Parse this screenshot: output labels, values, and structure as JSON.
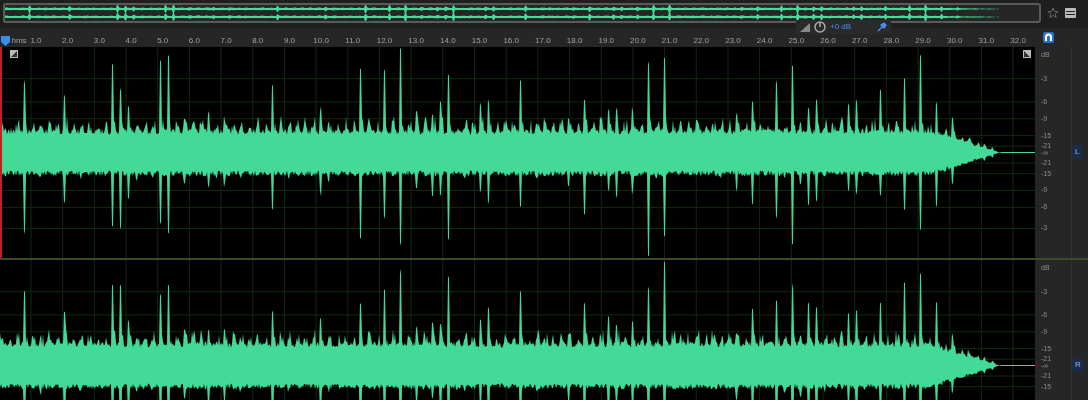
{
  "ruler": {
    "unit": "hms",
    "labels": [
      "1.0",
      "2.0",
      "3.0",
      "4.0",
      "5.0",
      "6.0",
      "7.0",
      "8.0",
      "9.0",
      "10.0",
      "11.0",
      "12.0",
      "13.0",
      "14.0",
      "15.0",
      "16.0",
      "17.0",
      "18.0",
      "19.0",
      "20.0",
      "21.0",
      "22.0",
      "23.0",
      "24.0",
      "25.0",
      "26.0",
      "27.0",
      "28.0",
      "29.0",
      "30.0",
      "31.0",
      "32.0"
    ]
  },
  "hud": {
    "gain": "+0 dB"
  },
  "channels": [
    {
      "label": "L",
      "unit": "dB",
      "scale": [
        "-3",
        "-6",
        "-9",
        "-15",
        "-21",
        "-∞",
        "-21",
        "-15",
        "-9",
        "-6",
        "-3"
      ]
    },
    {
      "label": "R",
      "unit": "dB",
      "scale": [
        "-3",
        "-6",
        "-9",
        "-15",
        "-21",
        "-∞",
        "-21",
        "-15"
      ]
    }
  ]
}
